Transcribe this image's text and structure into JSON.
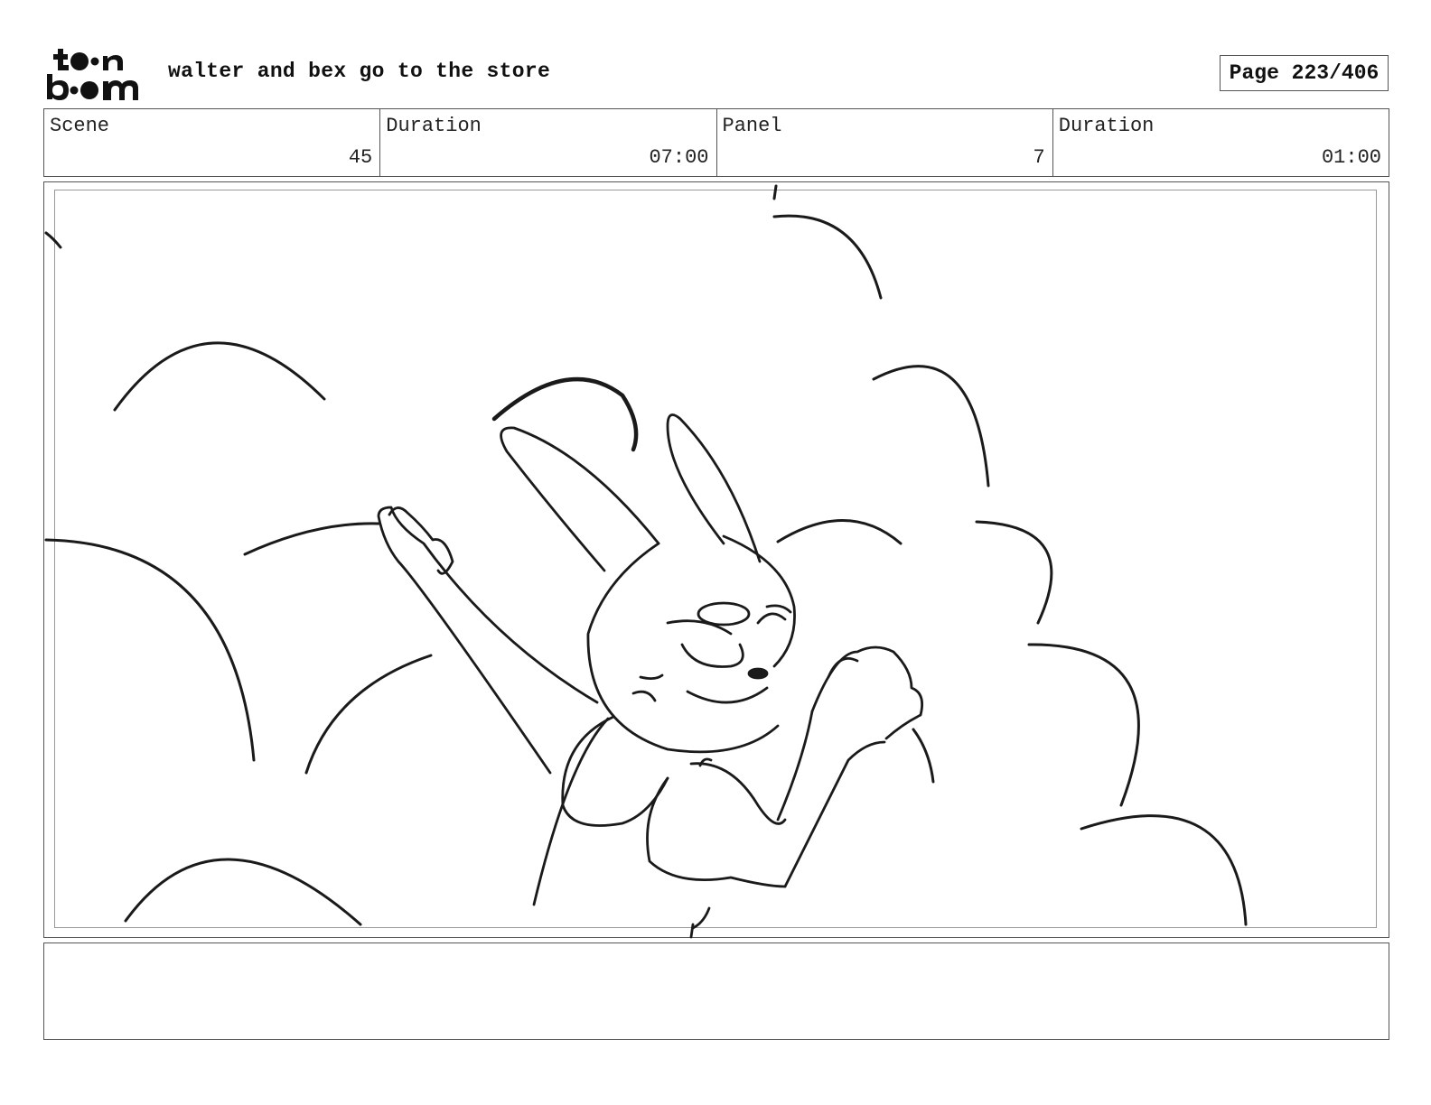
{
  "header": {
    "logo_text": "toon boom",
    "title": "walter and bex go to the store",
    "page_label": "Page 223/406"
  },
  "info": {
    "scene_label": "Scene",
    "scene_value": "45",
    "scene_duration_label": "Duration",
    "scene_duration_value": "07:00",
    "panel_label": "Panel",
    "panel_value": "7",
    "panel_duration_label": "Duration",
    "panel_duration_value": "01:00"
  },
  "notes": {
    "text": ""
  },
  "colors": {
    "ink": "#111111",
    "border": "#555555"
  }
}
